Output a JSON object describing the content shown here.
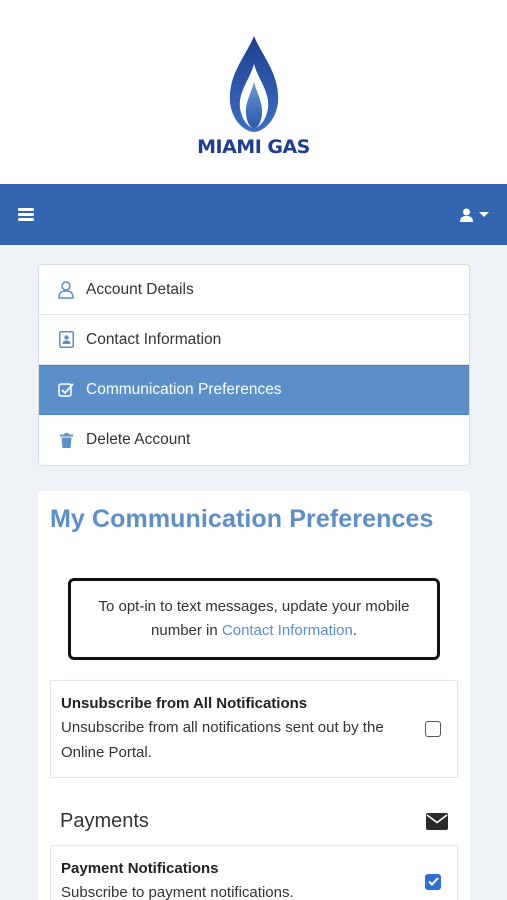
{
  "brand": {
    "name": "MIAMI GAS"
  },
  "nav": {
    "items": [
      {
        "label": "Account Details",
        "icon": "user-outline-icon",
        "active": false
      },
      {
        "label": "Contact Information",
        "icon": "contact-card-icon",
        "active": false
      },
      {
        "label": "Communication Preferences",
        "icon": "check-square-icon",
        "active": true
      },
      {
        "label": "Delete Account",
        "icon": "trash-icon",
        "active": false
      }
    ]
  },
  "main": {
    "title": "My Communication Preferences",
    "notice": {
      "before": "To opt-in to text messages, update your mobile number in ",
      "link": "Contact Information",
      "after": "."
    },
    "unsubscribe_all": {
      "title": "Unsubscribe from All Notifications",
      "description": "Unsubscribe from all notifications sent out by the Online Portal.",
      "checked": false
    },
    "payments": {
      "section_title": "Payments",
      "section_icon": "envelope-icon",
      "item": {
        "title": "Payment Notifications",
        "description": "Subscribe to payment notifications.",
        "checked": true
      }
    }
  },
  "colors": {
    "header_bg": "#3366b0",
    "accent": "#5b8fc9",
    "checkbox_checked": "#2d6fd6"
  }
}
